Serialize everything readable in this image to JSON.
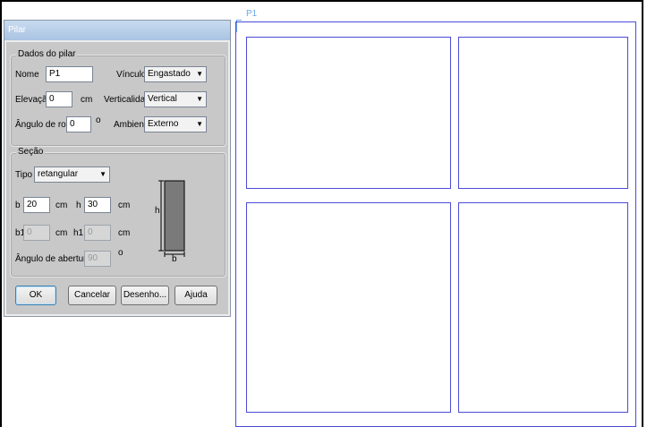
{
  "dialog": {
    "title": "Pilar",
    "dados": {
      "legend": "Dados do pilar",
      "nome_label": "Nome",
      "nome_value": "P1",
      "vinculo_label": "Vínculo",
      "vinculo_value": "Engastado",
      "elevacao_label": "Elevação",
      "elevacao_value": "0",
      "elevacao_unit": "cm",
      "verticalidade_label": "Verticalidade",
      "verticalidade_value": "Vertical",
      "angulo_label": "Ângulo de rotação",
      "angulo_value": "0",
      "angulo_unit": "o",
      "ambiente_label": "Ambiente",
      "ambiente_value": "Externo"
    },
    "secao": {
      "legend": "Seção",
      "tipo_label": "Tipo",
      "tipo_value": "retangular",
      "b_label": "b",
      "b_value": "20",
      "b_unit": "cm",
      "h_label": "h",
      "h_value": "30",
      "h_unit": "cm",
      "b1_label": "b1",
      "b1_value": "0",
      "b1_unit": "cm",
      "h1_label": "h1",
      "h1_value": "0",
      "h1_unit": "cm",
      "abertura_label": "Ângulo de abertura",
      "abertura_value": "90",
      "abertura_unit": "o",
      "diagram_h": "h",
      "diagram_b": "b"
    },
    "buttons": {
      "ok": "OK",
      "cancelar": "Cancelar",
      "desenho": "Desenho...",
      "ajuda": "Ajuda"
    }
  },
  "canvas": {
    "pillar_label": "P1"
  }
}
